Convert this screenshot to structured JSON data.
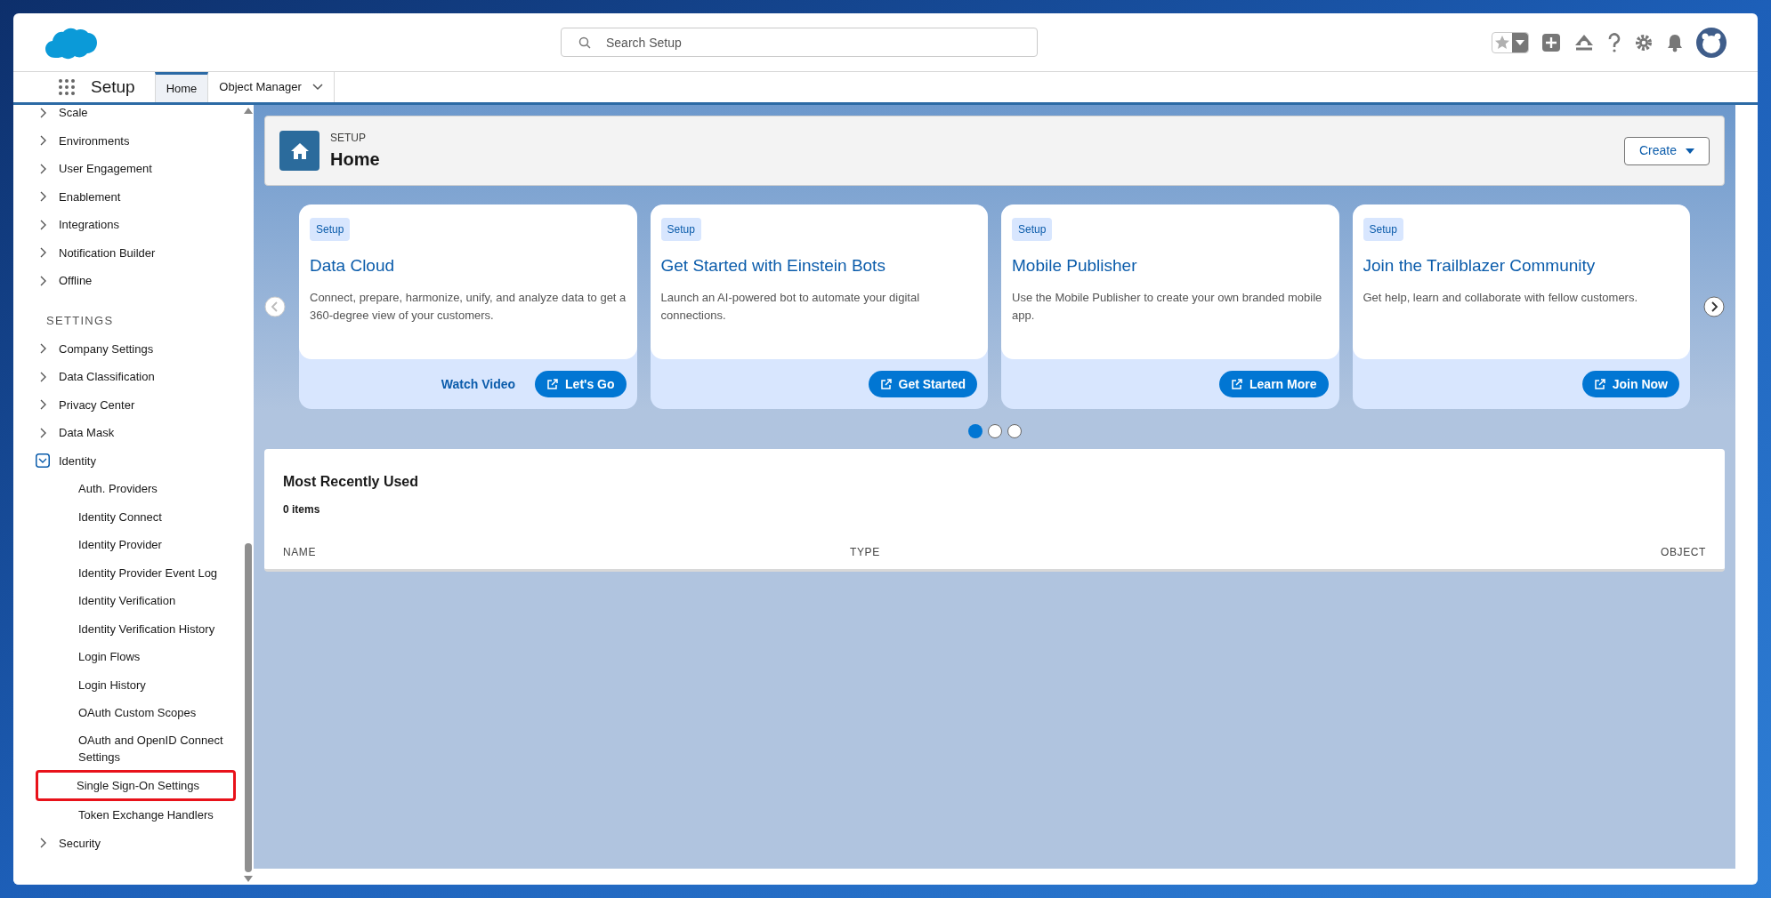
{
  "header": {
    "search": {
      "placeholder": "Search Setup"
    }
  },
  "nav": {
    "app_name": "Setup",
    "tabs": [
      {
        "label": "Home",
        "selected": true,
        "dropdown": false
      },
      {
        "label": "Object Manager",
        "selected": false,
        "dropdown": true
      }
    ]
  },
  "sidebar": {
    "entries": [
      {
        "kind": "item",
        "label": "Scale",
        "expanded": false
      },
      {
        "kind": "item",
        "label": "Environments",
        "expanded": false
      },
      {
        "kind": "item",
        "label": "User Engagement",
        "expanded": false
      },
      {
        "kind": "item",
        "label": "Enablement",
        "expanded": false
      },
      {
        "kind": "item",
        "label": "Integrations",
        "expanded": false
      },
      {
        "kind": "item",
        "label": "Notification Builder",
        "expanded": false
      },
      {
        "kind": "item",
        "label": "Offline",
        "expanded": false
      },
      {
        "kind": "heading",
        "label": "SETTINGS"
      },
      {
        "kind": "item",
        "label": "Company Settings",
        "expanded": false
      },
      {
        "kind": "item",
        "label": "Data Classification",
        "expanded": false
      },
      {
        "kind": "item",
        "label": "Privacy Center",
        "expanded": false
      },
      {
        "kind": "item",
        "label": "Data Mask",
        "expanded": false
      },
      {
        "kind": "item",
        "label": "Identity",
        "expanded": true,
        "children": [
          {
            "label": "Auth. Providers",
            "highlighted": false
          },
          {
            "label": "Identity Connect",
            "highlighted": false
          },
          {
            "label": "Identity Provider",
            "highlighted": false
          },
          {
            "label": "Identity Provider Event Log",
            "highlighted": false
          },
          {
            "label": "Identity Verification",
            "highlighted": false
          },
          {
            "label": "Identity Verification History",
            "highlighted": false
          },
          {
            "label": "Login Flows",
            "highlighted": false
          },
          {
            "label": "Login History",
            "highlighted": false
          },
          {
            "label": "OAuth Custom Scopes",
            "highlighted": false
          },
          {
            "label": "OAuth and OpenID Connect Settings",
            "highlighted": false
          },
          {
            "label": "Single Sign-On Settings",
            "highlighted": true
          },
          {
            "label": "Token Exchange Handlers",
            "highlighted": false
          }
        ]
      },
      {
        "kind": "item",
        "label": "Security",
        "expanded": false
      }
    ]
  },
  "page_header": {
    "eyebrow": "SETUP",
    "title": "Home",
    "button": "Create"
  },
  "carousel": {
    "cards": [
      {
        "tag": "Setup",
        "title": "Data Cloud",
        "description": "Connect, prepare, harmonize, unify, and analyze data to get a 360-degree view of your customers.",
        "link": "Watch Video",
        "button": "Let's Go"
      },
      {
        "tag": "Setup",
        "title": "Get Started with Einstein Bots",
        "description": "Launch an AI-powered bot to automate your digital connections.",
        "button": "Get Started"
      },
      {
        "tag": "Setup",
        "title": "Mobile Publisher",
        "description": "Use the Mobile Publisher to create your own branded mobile app.",
        "button": "Learn More"
      },
      {
        "tag": "Setup",
        "title": "Join the Trailblazer Community",
        "description": "Get help, learn and collaborate with fellow customers.",
        "button": "Join Now"
      }
    ],
    "dots": [
      {
        "selected": true
      },
      {
        "selected": false
      },
      {
        "selected": false
      }
    ]
  },
  "recent": {
    "title": "Most Recently Used",
    "count": "0 items",
    "columns": [
      "NAME",
      "TYPE",
      "OBJECT"
    ]
  }
}
